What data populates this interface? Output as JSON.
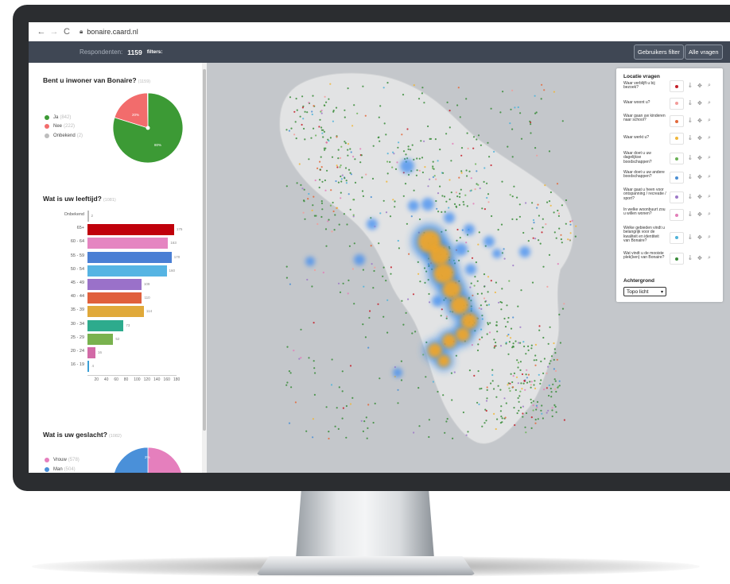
{
  "browser": {
    "back_icon": "arrow-left-icon",
    "forward_icon": "arrow-right-icon",
    "reload_icon": "reload-icon",
    "url": "bonaire.caard.nl"
  },
  "header": {
    "respondents_label": "Respondenten:",
    "respondents_count": "1159",
    "filters_label": "filters:",
    "user_filter_button": "Gebruikers filter",
    "all_questions_button": "Alle vragen"
  },
  "sidebar": {
    "q1": {
      "title": "Bent u inwoner van Bonaire?",
      "count": "(1159)",
      "legend": [
        {
          "label": "Ja",
          "count": "(842)",
          "color": "#3c9a35"
        },
        {
          "label": "Nee",
          "count": "(222)",
          "color": "#f26c6c"
        },
        {
          "label": "Onbekend",
          "count": "(2)",
          "color": "#bdbdbd"
        }
      ],
      "slice_labels": [
        "20%",
        "80%"
      ]
    },
    "q2": {
      "title": "Wat is uw leeftijd?",
      "count": "(1081)"
    },
    "q3": {
      "title": "Wat is uw geslacht?",
      "count": "(1082)",
      "legend": [
        {
          "label": "Vrouw",
          "count": "(578)",
          "color": "#e57fbd"
        },
        {
          "label": "Man",
          "count": "(504)",
          "color": "#4a90d9"
        }
      ],
      "slice_labels": [
        "2%"
      ]
    }
  },
  "chart_data": [
    {
      "type": "pie",
      "title": "Bent u inwoner van Bonaire?",
      "slices": [
        {
          "label": "Ja",
          "value": 80,
          "color": "#3c9a35"
        },
        {
          "label": "Nee",
          "value": 20,
          "color": "#f26c6c"
        },
        {
          "label": "Onbekend",
          "value": 0.2,
          "color": "#bdbdbd"
        }
      ]
    },
    {
      "type": "bar",
      "orientation": "horizontal",
      "title": "Wat is uw leeftijd?",
      "categories": [
        "Onbekend",
        "65+",
        "60 - 64",
        "55 - 59",
        "50 - 54",
        "45 - 49",
        "40 - 44",
        "35 - 39",
        "30 - 34",
        "25 - 29",
        "20 - 24",
        "16 - 19"
      ],
      "values": [
        2,
        175,
        163,
        170,
        160,
        109,
        110,
        114,
        73,
        52,
        16,
        4
      ],
      "value_labels": [
        "2",
        "175",
        "163",
        "170",
        "160",
        "109",
        "110",
        "114",
        "73",
        "52",
        "16",
        "4"
      ],
      "colors": [
        "#bdbdbd",
        "#c0000b",
        "#e585c1",
        "#4a7fd4",
        "#56b4e3",
        "#9a71c9",
        "#e0603c",
        "#e0a93a",
        "#2dab8d",
        "#79b24e",
        "#d26aa7",
        "#3a9fd6"
      ],
      "xticks": [
        "20",
        "40",
        "60",
        "80",
        "100",
        "120",
        "140",
        "160",
        "180"
      ],
      "xlim": [
        0,
        180
      ]
    },
    {
      "type": "pie",
      "title": "Wat is uw geslacht?",
      "slices": [
        {
          "label": "Vrouw",
          "value": 53,
          "color": "#e57fbd"
        },
        {
          "label": "Man",
          "value": 47,
          "color": "#4a90d9"
        }
      ]
    }
  ],
  "location_panel": {
    "title": "Locatie vragen",
    "items": [
      {
        "label": "Waar verblijft u bij bezoek?",
        "color": "#c4202a"
      },
      {
        "label": "Waar woont u?",
        "color": "#f29c9a"
      },
      {
        "label": "Waar gaan uw kinderen naar school?",
        "color": "#e36a3c"
      },
      {
        "label": "Waar werkt u?",
        "color": "#f0b63a"
      },
      {
        "label": "Waar doet u uw dagelijkse boodschappen?",
        "color": "#6bb257"
      },
      {
        "label": "Waar doet u uw andere boodschappen?",
        "color": "#4b8fd4"
      },
      {
        "label": "Waar gaat u heen voor ontspanning / recreatie / sport?",
        "color": "#9d79c7"
      },
      {
        "label": "In welke woonbuurt zou u willen wonen?",
        "color": "#e27fb8"
      },
      {
        "label": "Welke gebieden vindt u belangrijk voor de kwaliteit en identiteit van Bonaire?",
        "color": "#4fb3d9"
      },
      {
        "label": "Wat vindt u de mooiste plek(ken) van Bonaire?",
        "color": "#3a8c3a"
      }
    ],
    "background_label": "Achtergrond",
    "background_value": "Topo licht"
  }
}
